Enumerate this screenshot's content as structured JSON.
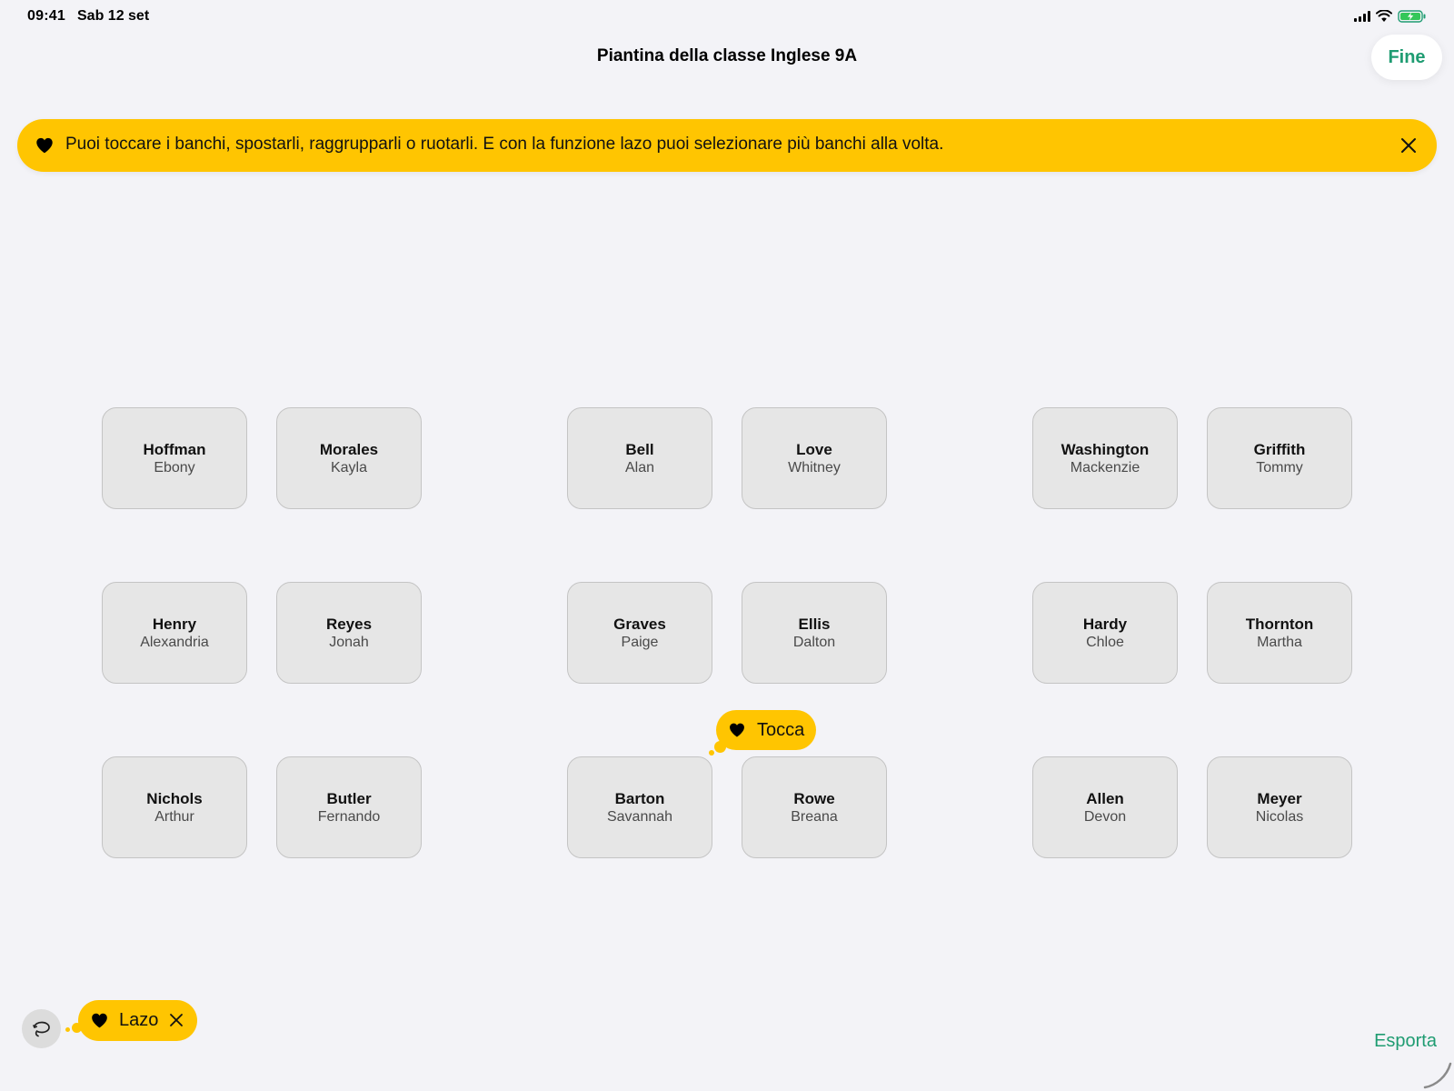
{
  "status_bar": {
    "time": "09:41",
    "date": "Sab 12 set"
  },
  "header": {
    "title": "Piantina della classe Inglese 9A",
    "done_label": "Fine"
  },
  "banner": {
    "text": "Puoi toccare i banchi, spostarli, raggrupparli o ruotarli. E con la funzione lazo puoi selezionare più banchi alla volta.",
    "icon": "heart-icon",
    "close_icon": "close-icon"
  },
  "desks": [
    {
      "last": "Hoffman",
      "first": "Ebony"
    },
    {
      "last": "Morales",
      "first": "Kayla"
    },
    {
      "last": "Bell",
      "first": "Alan"
    },
    {
      "last": "Love",
      "first": "Whitney"
    },
    {
      "last": "Washington",
      "first": "Mackenzie"
    },
    {
      "last": "Griffith",
      "first": "Tommy"
    },
    {
      "last": "Henry",
      "first": "Alexandria"
    },
    {
      "last": "Reyes",
      "first": "Jonah"
    },
    {
      "last": "Graves",
      "first": "Paige"
    },
    {
      "last": "Ellis",
      "first": "Dalton"
    },
    {
      "last": "Hardy",
      "first": "Chloe"
    },
    {
      "last": "Thornton",
      "first": "Martha"
    },
    {
      "last": "Nichols",
      "first": "Arthur"
    },
    {
      "last": "Butler",
      "first": "Fernando"
    },
    {
      "last": "Barton",
      "first": "Savannah"
    },
    {
      "last": "Rowe",
      "first": "Breana"
    },
    {
      "last": "Allen",
      "first": "Devon"
    },
    {
      "last": "Meyer",
      "first": "Nicolas"
    }
  ],
  "tooltip": {
    "label": "Tocca"
  },
  "lasso": {
    "label": "Lazo",
    "button_icon": "lasso-icon"
  },
  "footer": {
    "export_label": "Esporta"
  },
  "colors": {
    "accent": "#1f9c72",
    "highlight": "#ffc501",
    "background": "#f3f3f7",
    "desk": "#e6e6e6"
  }
}
